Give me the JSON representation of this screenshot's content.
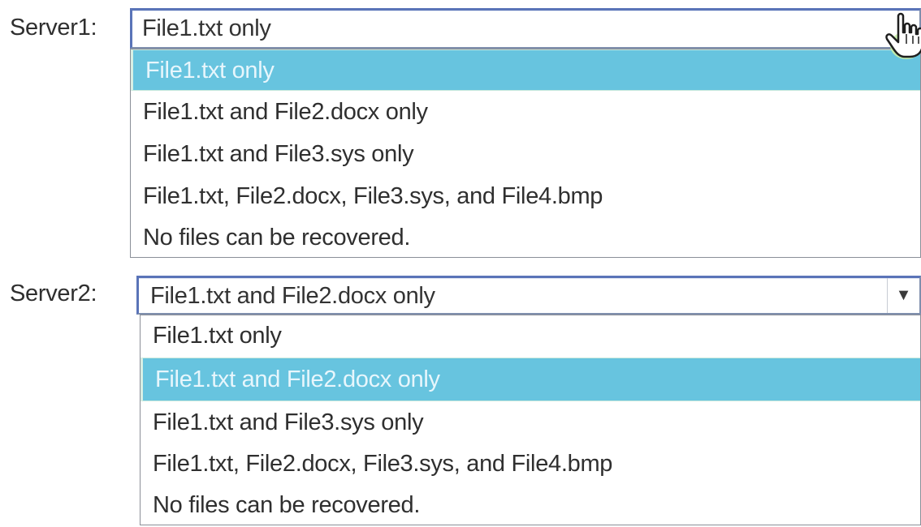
{
  "server1": {
    "label": "Server1:",
    "value": "File1.txt only",
    "options": [
      "File1.txt only",
      "File1.txt and File2.docx only",
      "File1.txt and File3.sys only",
      "File1.txt, File2.docx, File3.sys, and File4.bmp",
      "No files can be recovered."
    ],
    "selected_index": 0
  },
  "server2": {
    "label": "Server2:",
    "value": "File1.txt and File2.docx only",
    "options": [
      "File1.txt only",
      "File1.txt and File2.docx only",
      "File1.txt and File3.sys only",
      "File1.txt, File2.docx, File3.sys, and File4.bmp",
      "No files can be recovered."
    ],
    "selected_index": 1
  },
  "icons": {
    "dropdown_arrow": "chevron-down-icon",
    "cursor": "hand-pointer-icon"
  },
  "colors": {
    "selection_background": "#67c4df",
    "selection_text": "#e7f6fc",
    "select_border": "#5a74b8"
  }
}
